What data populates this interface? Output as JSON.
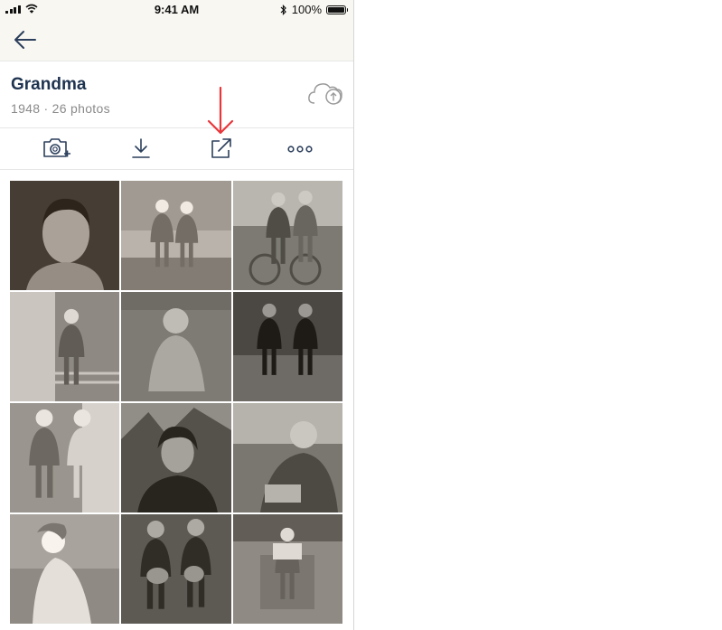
{
  "status_bar": {
    "time": "9:41 AM",
    "battery_text": "100%",
    "battery_level": 1.0
  },
  "album": {
    "title": "Grandma",
    "subtitle": "1948 · 26 photos"
  },
  "icons": {
    "back": "back-arrow-icon",
    "cloud": "cloud-upload-icon",
    "camera": "camera-add-icon",
    "download": "download-icon",
    "share": "share-external-icon",
    "more": "more-options-icon",
    "annotation": "red-arrow-annotation"
  },
  "colors": {
    "title": "#1e3350",
    "icon": "#2b3f5c",
    "annotation": "#e8373c",
    "topbar": "#f8f7f2"
  },
  "photos": [
    {
      "tone": "#5a5148",
      "subject": "portrait-young-man"
    },
    {
      "tone": "#a09a92",
      "subject": "two-people-on-beach"
    },
    {
      "tone": "#7d7a74",
      "subject": "two-women-with-bicycle"
    },
    {
      "tone": "#8e8a83",
      "subject": "woman-on-balcony"
    },
    {
      "tone": "#6f6b65",
      "subject": "child-on-sofa"
    },
    {
      "tone": "#4b4843",
      "subject": "two-women-seated"
    },
    {
      "tone": "#9a968f",
      "subject": "two-women-standing"
    },
    {
      "tone": "#55524c",
      "subject": "woman-portrait-outdoors"
    },
    {
      "tone": "#7a7670",
      "subject": "woman-reading"
    },
    {
      "tone": "#a8a49d",
      "subject": "woman-at-seaside"
    },
    {
      "tone": "#5d5a54",
      "subject": "couple-with-dogs"
    },
    {
      "tone": "#8f8b84",
      "subject": "woman-in-chair"
    }
  ]
}
